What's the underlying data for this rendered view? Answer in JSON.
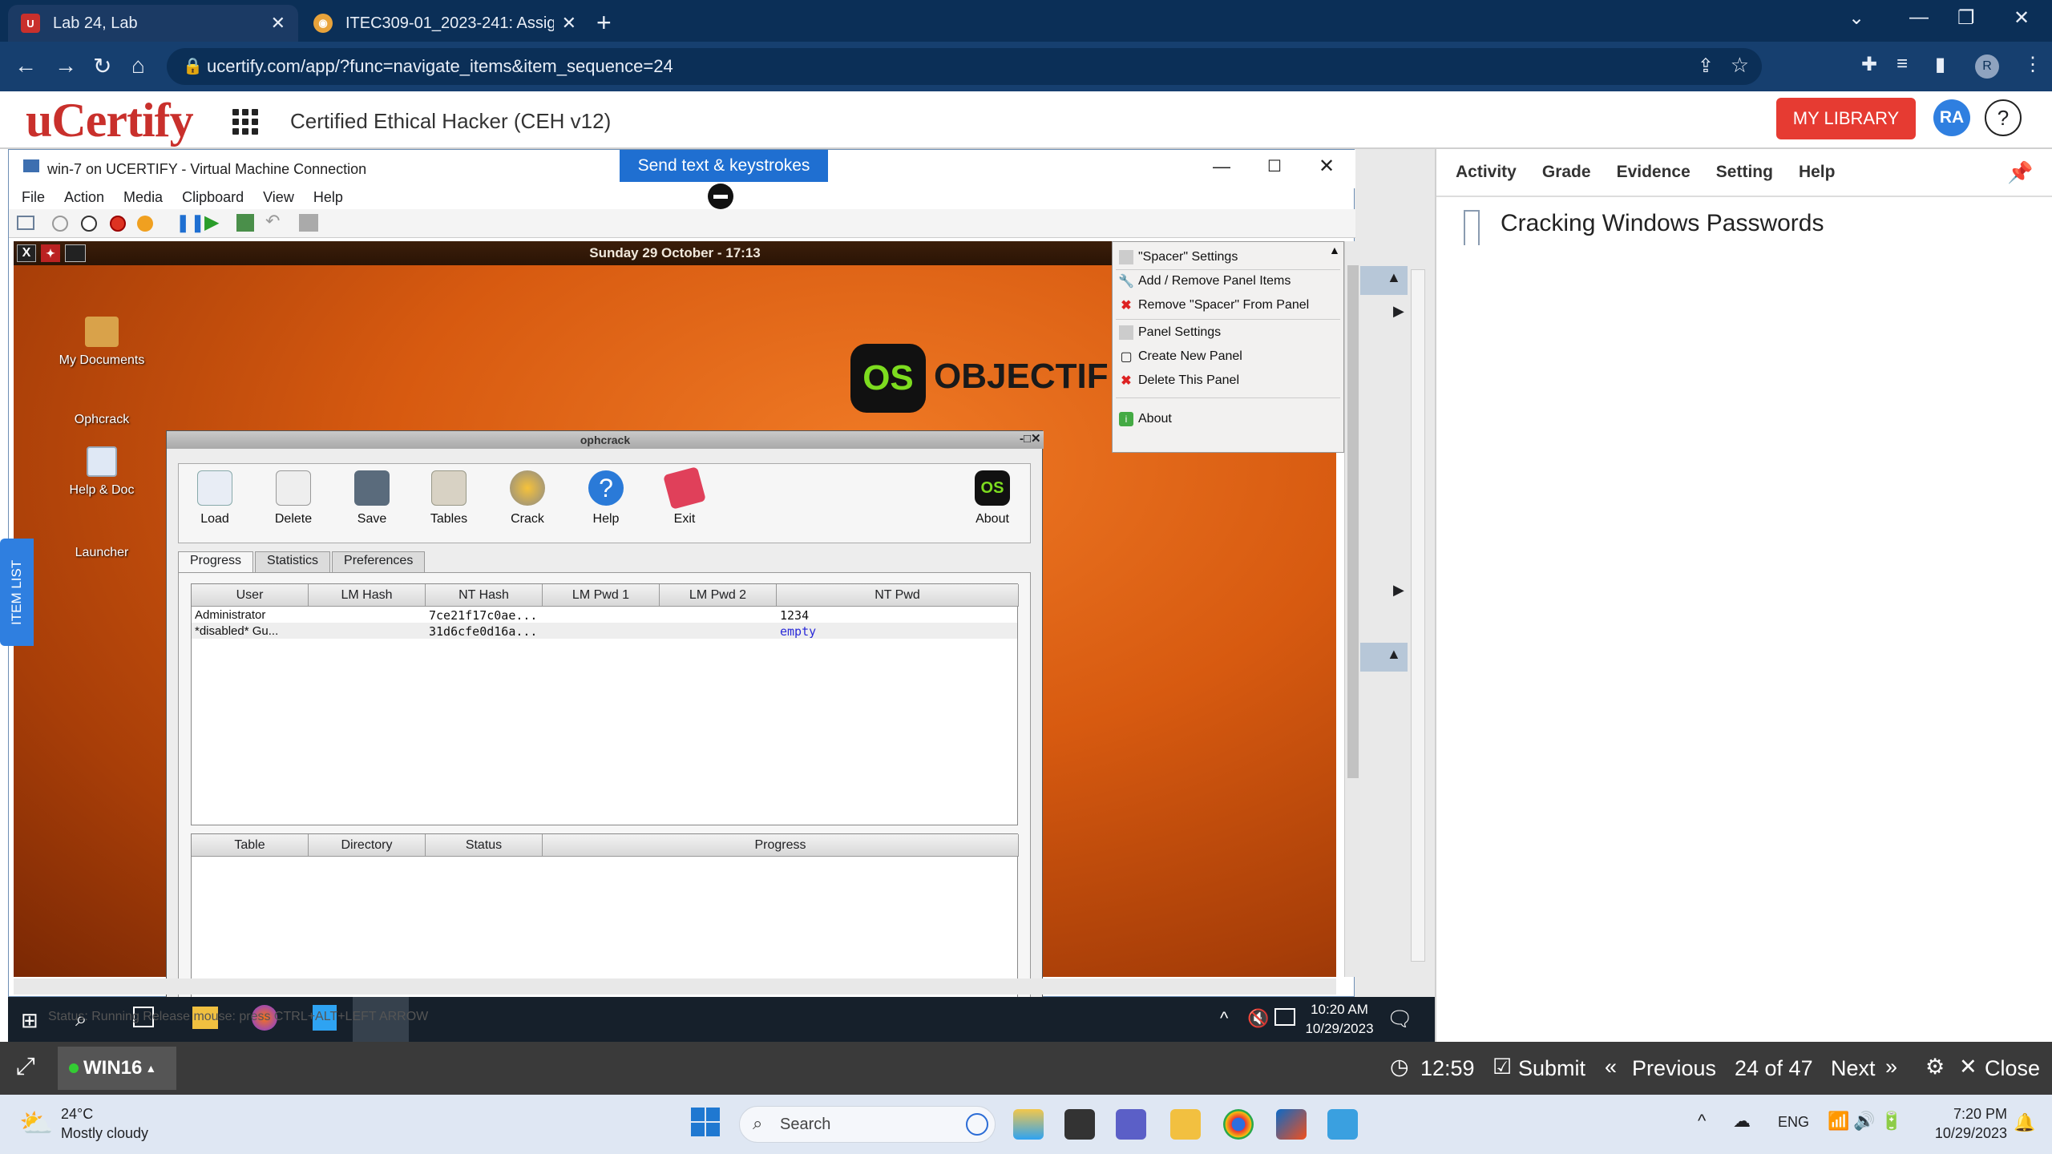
{
  "browser": {
    "tabs": [
      {
        "title": "Lab 24, Lab",
        "close": "✕"
      },
      {
        "title": "ITEC309-01_2023-241: Assignme",
        "close": "✕"
      }
    ],
    "new_tab": "+",
    "url": "ucertify.com/app/?func=navigate_items&item_sequence=24",
    "profile": "R"
  },
  "ucertify": {
    "logo": "uCertify",
    "course": "Certified Ethical Hacker (CEH v12)",
    "my_library": "MY LIBRARY",
    "avatar": "RA",
    "help": "?",
    "panel_tabs": [
      "Activity",
      "Grade",
      "Evidence",
      "Setting",
      "Help"
    ],
    "lesson_title": "Cracking Windows Passwords",
    "item_list": "ITEM LIST"
  },
  "vm": {
    "title": "win-7 on UCERTIFY - Virtual Machine Connection",
    "send_text": "Send text & keystrokes",
    "menu": [
      "File",
      "Action",
      "Media",
      "Clipboard",
      "View",
      "Help"
    ],
    "guest": {
      "clock": "Sunday 29 October - 17:13",
      "desktop_icons": [
        "My Documents",
        "Ophcrack",
        "Help & Doc",
        "Launcher"
      ],
      "brand_os": "OS",
      "brand_text": "OBJECTIF",
      "context_menu": [
        "\"Spacer\" Settings",
        "Add / Remove Panel Items",
        "Remove \"Spacer\" From Panel",
        "Panel Settings",
        "Create New Panel",
        "Delete This Panel",
        "About"
      ]
    },
    "ophcrack": {
      "title": "ophcrack",
      "toolbar": [
        "Load",
        "Delete",
        "Save",
        "Tables",
        "Crack",
        "Help",
        "Exit",
        "About"
      ],
      "about_logo": "OS",
      "tabs": [
        "Progress",
        "Statistics",
        "Preferences"
      ],
      "columns": [
        "User",
        "LM Hash",
        "NT Hash",
        "LM Pwd 1",
        "LM Pwd 2",
        "NT Pwd"
      ],
      "rows": [
        {
          "user": "Administrator",
          "nt_hash": "7ce21f17c0ae...",
          "nt_pwd": "1234"
        },
        {
          "user": "*disabled* Gu...",
          "nt_hash": "31d6cfe0d16a...",
          "nt_pwd": "empty"
        }
      ],
      "table_columns": [
        "Table",
        "Directory",
        "Status",
        "Progress"
      ]
    },
    "inner_taskbar": {
      "status_text": "Status: Running   Release mouse: press CTRL+ALT+LEFT ARROW",
      "time": "10:20 AM",
      "date": "10/29/2023"
    }
  },
  "footer": {
    "machine": "WIN16",
    "timer": "12:59",
    "submit": "Submit",
    "previous": "Previous",
    "position": "24 of 47",
    "next": "Next",
    "close": "Close"
  },
  "host_taskbar": {
    "temp": "24°C",
    "weather": "Mostly cloudy",
    "search": "Search",
    "lang": "ENG",
    "time": "7:20 PM",
    "date": "10/29/2023"
  }
}
